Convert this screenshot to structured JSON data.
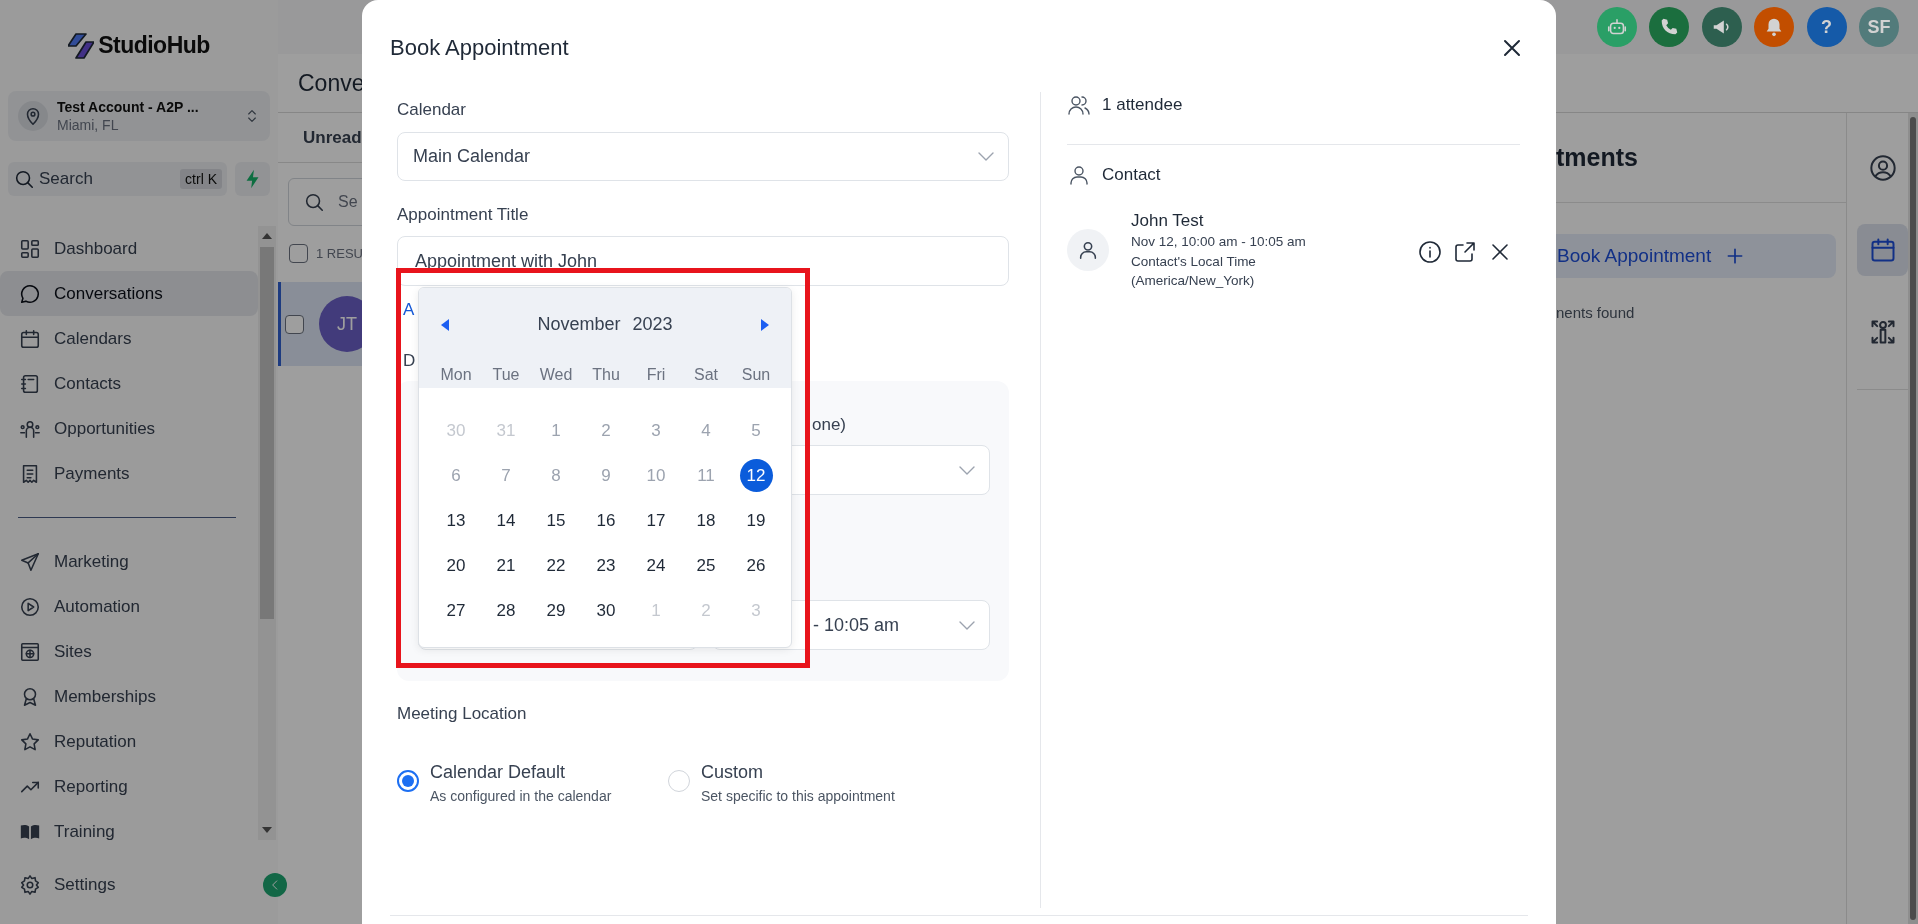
{
  "sidebar": {
    "logo": "StudioHub",
    "account": {
      "name": "Test Account - A2P ...",
      "location": "Miami, FL"
    },
    "search": {
      "placeholder": "Search",
      "shortcut": "ctrl K"
    },
    "nav_groups": [
      [
        {
          "label": "Dashboard",
          "selected": false
        },
        {
          "label": "Conversations",
          "selected": true
        },
        {
          "label": "Calendars",
          "selected": false
        },
        {
          "label": "Contacts",
          "selected": false
        },
        {
          "label": "Opportunities",
          "selected": false
        },
        {
          "label": "Payments",
          "selected": false
        }
      ],
      [
        {
          "label": "Marketing",
          "selected": false
        },
        {
          "label": "Automation",
          "selected": false
        },
        {
          "label": "Sites",
          "selected": false
        },
        {
          "label": "Memberships",
          "selected": false
        },
        {
          "label": "Reputation",
          "selected": false
        },
        {
          "label": "Reporting",
          "selected": false
        },
        {
          "label": "Training",
          "selected": false
        }
      ]
    ],
    "settings": "Settings"
  },
  "header_buttons": [
    {
      "kind": "icon",
      "color": "#2a9f66"
    },
    {
      "kind": "icon",
      "color": "#1b6e3e"
    },
    {
      "kind": "icon",
      "color": "#2d5f4f"
    },
    {
      "kind": "icon",
      "color": "#c24e00"
    },
    {
      "kind": "text",
      "text": "?",
      "color": "#155aa8"
    },
    {
      "kind": "text",
      "text": "SF",
      "color": "#527b7b"
    }
  ],
  "conversations": {
    "title": "Conve",
    "tab": "Unread",
    "search_placeholder": "Se",
    "results": "1 RESU",
    "results_checked": false,
    "row": {
      "initials": "JT",
      "selected": true,
      "checked": false
    }
  },
  "appointments": {
    "title": "tments",
    "button": "Book Appointment",
    "empty": "nents found"
  },
  "right_rail": [
    {
      "selected": false
    },
    {
      "selected": true
    },
    {
      "selected": false
    }
  ],
  "modal": {
    "title": "Book Appointment",
    "calendar_field": {
      "label": "Calendar",
      "value": "Main Calendar"
    },
    "title_field": {
      "label": "Appointment Title",
      "value": "Appointment with John"
    },
    "link_fragment": "A",
    "date_label_fragment": "D",
    "timezone_label_fragment": "one)",
    "time_value_fragment": "- 10:05 am",
    "date_picker": {
      "month": "November",
      "year": "2023",
      "weekdays": [
        "Mon",
        "Tue",
        "Wed",
        "Thu",
        "Fri",
        "Sat",
        "Sun"
      ],
      "days": [
        {
          "label": "30",
          "in_month": false,
          "disabled": true,
          "selected": false
        },
        {
          "label": "31",
          "in_month": false,
          "disabled": true,
          "selected": false
        },
        {
          "label": "1",
          "in_month": true,
          "disabled": true,
          "selected": false
        },
        {
          "label": "2",
          "in_month": true,
          "disabled": true,
          "selected": false
        },
        {
          "label": "3",
          "in_month": true,
          "disabled": true,
          "selected": false
        },
        {
          "label": "4",
          "in_month": true,
          "disabled": true,
          "selected": false
        },
        {
          "label": "5",
          "in_month": true,
          "disabled": true,
          "selected": false
        },
        {
          "label": "6",
          "in_month": true,
          "disabled": true,
          "selected": false
        },
        {
          "label": "7",
          "in_month": true,
          "disabled": true,
          "selected": false
        },
        {
          "label": "8",
          "in_month": true,
          "disabled": true,
          "selected": false
        },
        {
          "label": "9",
          "in_month": true,
          "disabled": true,
          "selected": false
        },
        {
          "label": "10",
          "in_month": true,
          "disabled": true,
          "selected": false
        },
        {
          "label": "11",
          "in_month": true,
          "disabled": true,
          "selected": false
        },
        {
          "label": "12",
          "in_month": true,
          "disabled": false,
          "selected": true
        },
        {
          "label": "13",
          "in_month": true,
          "disabled": false,
          "selected": false
        },
        {
          "label": "14",
          "in_month": true,
          "disabled": false,
          "selected": false
        },
        {
          "label": "15",
          "in_month": true,
          "disabled": false,
          "selected": false
        },
        {
          "label": "16",
          "in_month": true,
          "disabled": false,
          "selected": false
        },
        {
          "label": "17",
          "in_month": true,
          "disabled": false,
          "selected": false
        },
        {
          "label": "18",
          "in_month": true,
          "disabled": false,
          "selected": false
        },
        {
          "label": "19",
          "in_month": true,
          "disabled": false,
          "selected": false
        },
        {
          "label": "20",
          "in_month": true,
          "disabled": false,
          "selected": false
        },
        {
          "label": "21",
          "in_month": true,
          "disabled": false,
          "selected": false
        },
        {
          "label": "22",
          "in_month": true,
          "disabled": false,
          "selected": false
        },
        {
          "label": "23",
          "in_month": true,
          "disabled": false,
          "selected": false
        },
        {
          "label": "24",
          "in_month": true,
          "disabled": false,
          "selected": false
        },
        {
          "label": "25",
          "in_month": true,
          "disabled": false,
          "selected": false
        },
        {
          "label": "26",
          "in_month": true,
          "disabled": false,
          "selected": false
        },
        {
          "label": "27",
          "in_month": true,
          "disabled": false,
          "selected": false
        },
        {
          "label": "28",
          "in_month": true,
          "disabled": false,
          "selected": false
        },
        {
          "label": "29",
          "in_month": true,
          "disabled": false,
          "selected": false
        },
        {
          "label": "30",
          "in_month": true,
          "disabled": false,
          "selected": false
        },
        {
          "label": "1",
          "in_month": false,
          "disabled": true,
          "selected": false
        },
        {
          "label": "2",
          "in_month": false,
          "disabled": true,
          "selected": false
        },
        {
          "label": "3",
          "in_month": false,
          "disabled": true,
          "selected": false
        }
      ]
    },
    "meeting_location": {
      "label": "Meeting Location",
      "options": [
        {
          "title": "Calendar Default",
          "description": "As configured in the calendar",
          "selected": true
        },
        {
          "title": "Custom",
          "description": "Set specific to this appointment",
          "selected": false
        }
      ]
    },
    "attendees": {
      "count": "1 attendee",
      "section": "Contact",
      "contacts": [
        {
          "name": "John Test",
          "time": "Nov 12, 10:00 am - 10:05 am",
          "note": "Contact's Local Time",
          "timezone": "(America/New_York)"
        }
      ]
    }
  }
}
